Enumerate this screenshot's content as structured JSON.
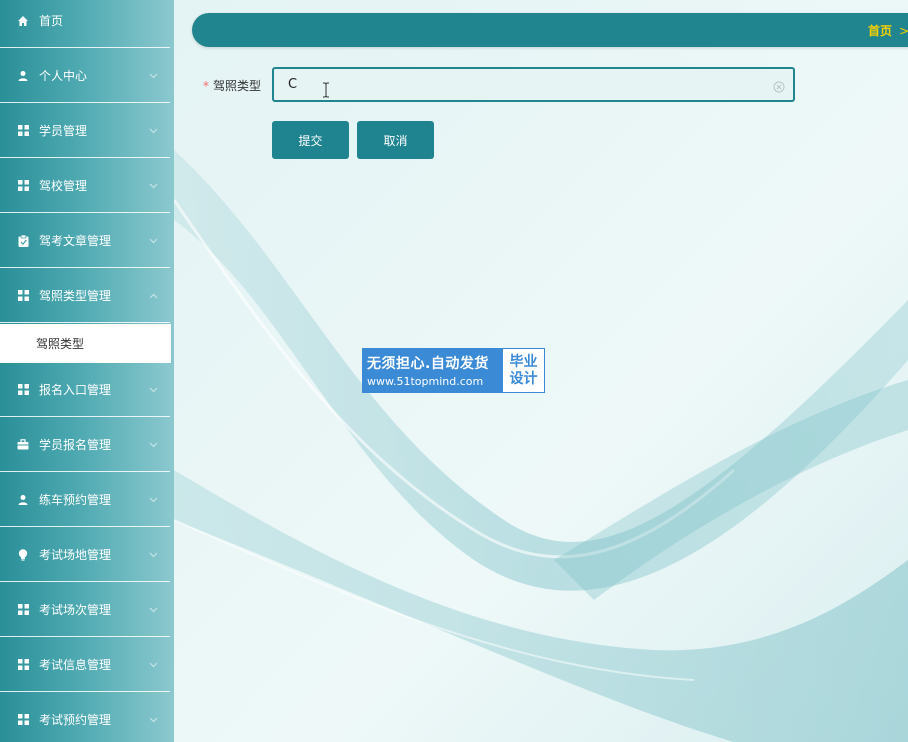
{
  "sidebar": {
    "items": [
      {
        "label": "首页",
        "icon": "home-icon"
      },
      {
        "label": "个人中心",
        "icon": "user-icon"
      },
      {
        "label": "学员管理",
        "icon": "grid-icon"
      },
      {
        "label": "驾校管理",
        "icon": "grid-icon"
      },
      {
        "label": "驾考文章管理",
        "icon": "clipboard-icon"
      },
      {
        "label": "驾照类型管理",
        "icon": "grid-icon"
      },
      {
        "label": "报名入口管理",
        "icon": "grid-icon"
      },
      {
        "label": "学员报名管理",
        "icon": "briefcase-icon"
      },
      {
        "label": "练车预约管理",
        "icon": "user-icon"
      },
      {
        "label": "考试场地管理",
        "icon": "bulb-icon"
      },
      {
        "label": "考试场次管理",
        "icon": "grid-icon"
      },
      {
        "label": "考试信息管理",
        "icon": "grid-icon"
      },
      {
        "label": "考试预约管理",
        "icon": "grid-icon"
      }
    ],
    "active_submenu": {
      "label": "驾照类型"
    }
  },
  "header": {
    "breadcrumb_home": "首页",
    "breadcrumb_sep": ">"
  },
  "form": {
    "field_label": "驾照类型",
    "required_mark": "*",
    "field_value": "C",
    "submit_label": "提交",
    "cancel_label": "取消"
  },
  "watermark": {
    "line1": "无须担心.自动发货",
    "line2": "www.51topmind.com",
    "badge_line1": "毕业",
    "badge_line2": "设计"
  },
  "colors": {
    "accent": "#21858f",
    "breadcrumb": "#f5d000",
    "required": "#f56c6c",
    "watermark_blue": "#3a8ad6"
  }
}
